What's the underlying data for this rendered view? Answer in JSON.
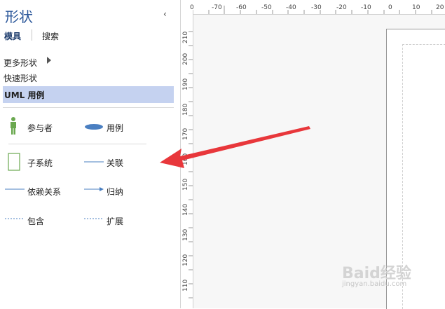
{
  "panel": {
    "title": "形状",
    "tabs": [
      {
        "label": "模具",
        "active": true
      },
      {
        "label": "搜索",
        "active": false
      }
    ],
    "menu": {
      "more_shapes": "更多形状",
      "quick_shapes": "快速形状",
      "selected_stencil": "UML 用例"
    },
    "shapes": [
      {
        "label": "参与者",
        "icon": "actor-icon"
      },
      {
        "label": "用例",
        "icon": "use-case-ellipse-icon"
      },
      {
        "label": "子系统",
        "icon": "subsystem-rect-icon"
      },
      {
        "label": "关联",
        "icon": "association-line-icon"
      },
      {
        "label": "依赖关系",
        "icon": "dependency-line-icon"
      },
      {
        "label": "归纳",
        "icon": "generalization-arrow-icon"
      },
      {
        "label": "包含",
        "icon": "include-dashed-icon"
      },
      {
        "label": "扩展",
        "icon": "extend-dashed-icon"
      }
    ]
  },
  "ruler": {
    "top": [
      "0",
      "-70",
      "-60",
      "-50",
      "-40",
      "-30",
      "-20",
      "-10",
      "0",
      "10",
      "20"
    ],
    "left": [
      "210",
      "200",
      "190",
      "180",
      "170",
      "160",
      "150",
      "140",
      "130",
      "120",
      "110"
    ]
  },
  "watermark": {
    "main": "Baid经验",
    "sub": "jingyan.baidu.com"
  },
  "colors": {
    "accent": "#2b579a",
    "selection": "#c5d2f0",
    "actor_green": "#6aa84f",
    "line_blue": "#4a7fc1",
    "annotation_arrow": "#e8373b"
  }
}
